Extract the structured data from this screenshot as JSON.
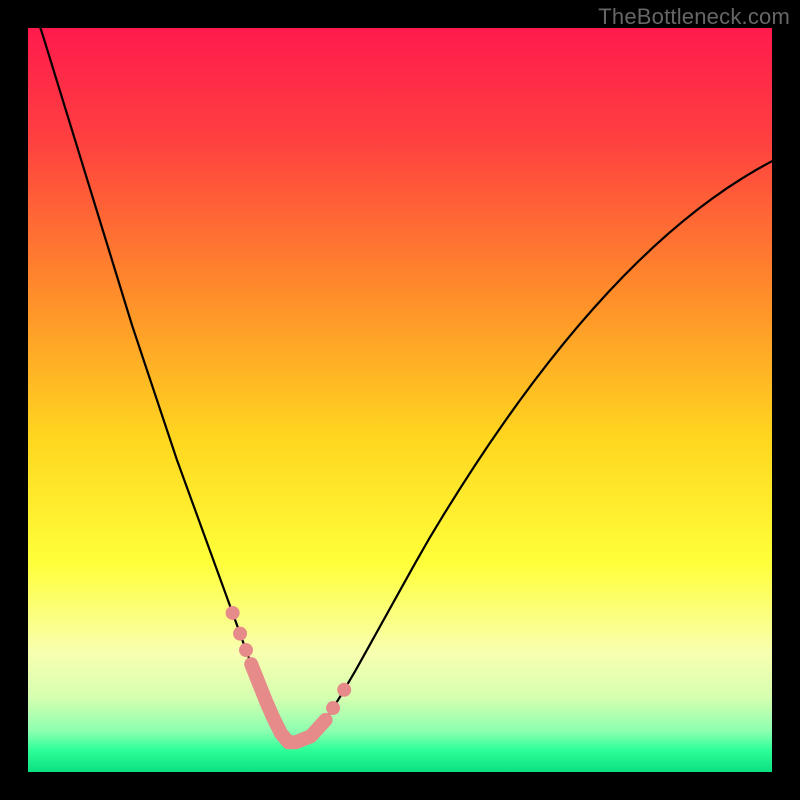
{
  "watermark": "TheBottleneck.com",
  "chart_data": {
    "type": "line",
    "title": "",
    "xlabel": "",
    "ylabel": "",
    "xlim": [
      0,
      100
    ],
    "ylim": [
      0,
      100
    ],
    "x": [
      0,
      2,
      4,
      6,
      8,
      10,
      12,
      14,
      16,
      18,
      20,
      22,
      24,
      26,
      28,
      29,
      30,
      31,
      32,
      33,
      34,
      35,
      36,
      38,
      40,
      42,
      44,
      46,
      48,
      50,
      52,
      54,
      56,
      58,
      60,
      62,
      64,
      66,
      68,
      70,
      72,
      74,
      76,
      78,
      80,
      82,
      84,
      86,
      88,
      90,
      92,
      94,
      96,
      98,
      100
    ],
    "values": [
      105,
      99,
      92.5,
      86,
      79.5,
      73,
      66.5,
      60,
      54,
      48,
      42,
      36.5,
      31,
      25.5,
      20,
      17.2,
      14.5,
      12,
      9.5,
      7.2,
      5.2,
      4.0,
      4.0,
      4.8,
      7.0,
      10.2,
      13.6,
      17.2,
      20.8,
      24.4,
      28.0,
      31.5,
      34.8,
      38.0,
      41.1,
      44.1,
      47.0,
      49.8,
      52.5,
      55.1,
      57.6,
      60.0,
      62.3,
      64.5,
      66.6,
      68.6,
      70.5,
      72.3,
      74.0,
      75.6,
      77.1,
      78.5,
      79.8,
      81.0,
      82.1
    ],
    "notes": "Black curve on rainbow vertical gradient background. Near the minimum (~x=30..40) the curve thickens and is rendered in salmon with dotted texture, plus a few salmon dots on the approach slopes. Axis ticks/labels are not shown.",
    "gradient_stops": [
      {
        "offset": 0.0,
        "color": "#ff1a4d"
      },
      {
        "offset": 0.15,
        "color": "#ff4040"
      },
      {
        "offset": 0.35,
        "color": "#ff8a2b"
      },
      {
        "offset": 0.55,
        "color": "#ffd61f"
      },
      {
        "offset": 0.72,
        "color": "#ffff3a"
      },
      {
        "offset": 0.84,
        "color": "#f8ffb0"
      },
      {
        "offset": 0.9,
        "color": "#d6ffb0"
      },
      {
        "offset": 0.945,
        "color": "#8cffb0"
      },
      {
        "offset": 0.97,
        "color": "#2fff99"
      },
      {
        "offset": 1.0,
        "color": "#0be081"
      }
    ],
    "highlight_color": "#e78a8a"
  }
}
